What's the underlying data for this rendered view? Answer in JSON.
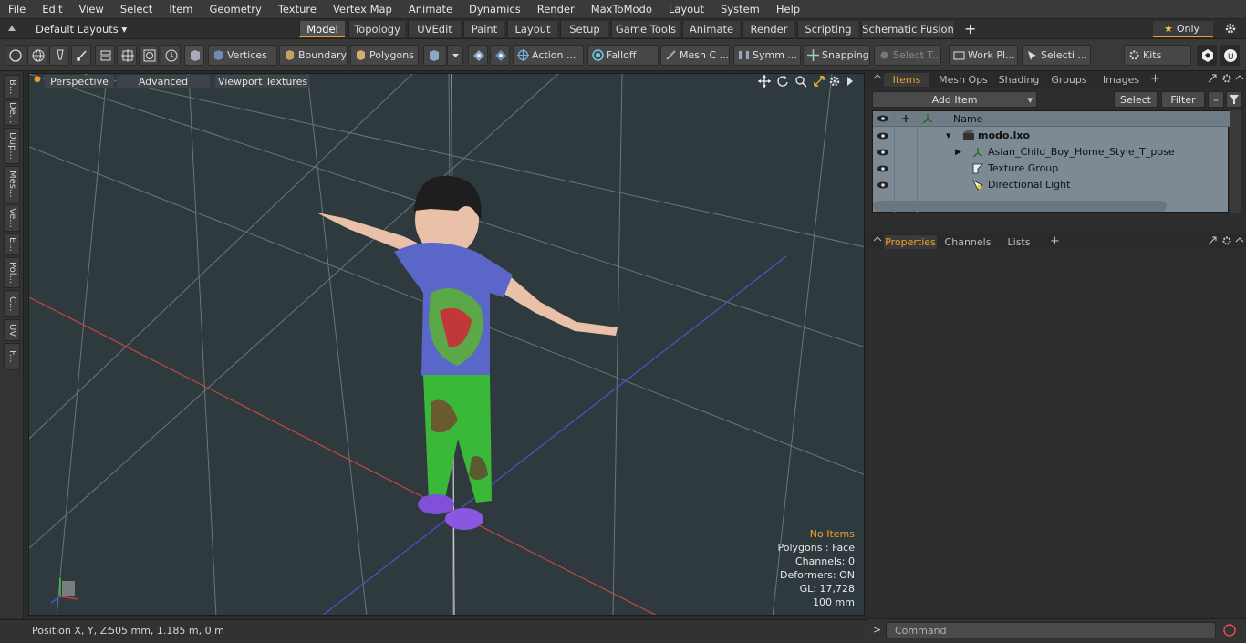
{
  "menu": [
    "File",
    "Edit",
    "View",
    "Select",
    "Item",
    "Geometry",
    "Texture",
    "Vertex Map",
    "Animate",
    "Dynamics",
    "Render",
    "MaxToModo",
    "Layout",
    "System",
    "Help"
  ],
  "layout_label": "Default Layouts",
  "top_tabs": [
    "Model",
    "Topology",
    "UVEdit",
    "Paint",
    "Layout",
    "Setup",
    "Game Tools",
    "Animate",
    "Render",
    "Scripting",
    "Schematic Fusion"
  ],
  "only_label": "Only",
  "toolbar": {
    "vertices": "Vertices",
    "boundary": "Boundary",
    "polygons": "Polygons",
    "action": "Action",
    "falloff": "Falloff",
    "mesh": "Mesh C ...",
    "symm": "Symm ...",
    "snapping": "Snapping",
    "select_t": "Select T...",
    "work": "Work Pl...",
    "selecti": "Selecti ...",
    "kits": "Kits"
  },
  "left_tabs": [
    "B...",
    "De...",
    "Dup...",
    "Mes...",
    "Ve...",
    "E...",
    "Pol...",
    "C...",
    "UV",
    "F..."
  ],
  "viewport": {
    "perspective": "Perspective",
    "advanced": "Advanced",
    "textures": "Viewport Textures"
  },
  "hud": {
    "no_items": "No Items",
    "polygons": "Polygons : Face",
    "channels": "Channels: 0",
    "deformers": "Deformers: ON",
    "gl": "GL: 17,728",
    "scale": "100 mm"
  },
  "status": {
    "position": "Position X, Y, Z:",
    "value": "505 mm, 1.185 m, 0 m"
  },
  "panel": {
    "tabs": [
      "Items",
      "Mesh Ops",
      "Shading",
      "Groups",
      "Images"
    ],
    "add_item": "Add Item",
    "select": "Select",
    "filter": "Filter",
    "name_col": "Name",
    "items": [
      "modo.lxo",
      "Asian_Child_Boy_Home_Style_T_pose",
      "Texture Group",
      "Directional Light"
    ],
    "prop_tabs": [
      "Properties",
      "Channels",
      "Lists"
    ],
    "command": "Command"
  },
  "colors": {
    "accent": "#e89a2c",
    "list_bg": "#7d8a94",
    "viewport_bg": "#2f3a3f"
  }
}
